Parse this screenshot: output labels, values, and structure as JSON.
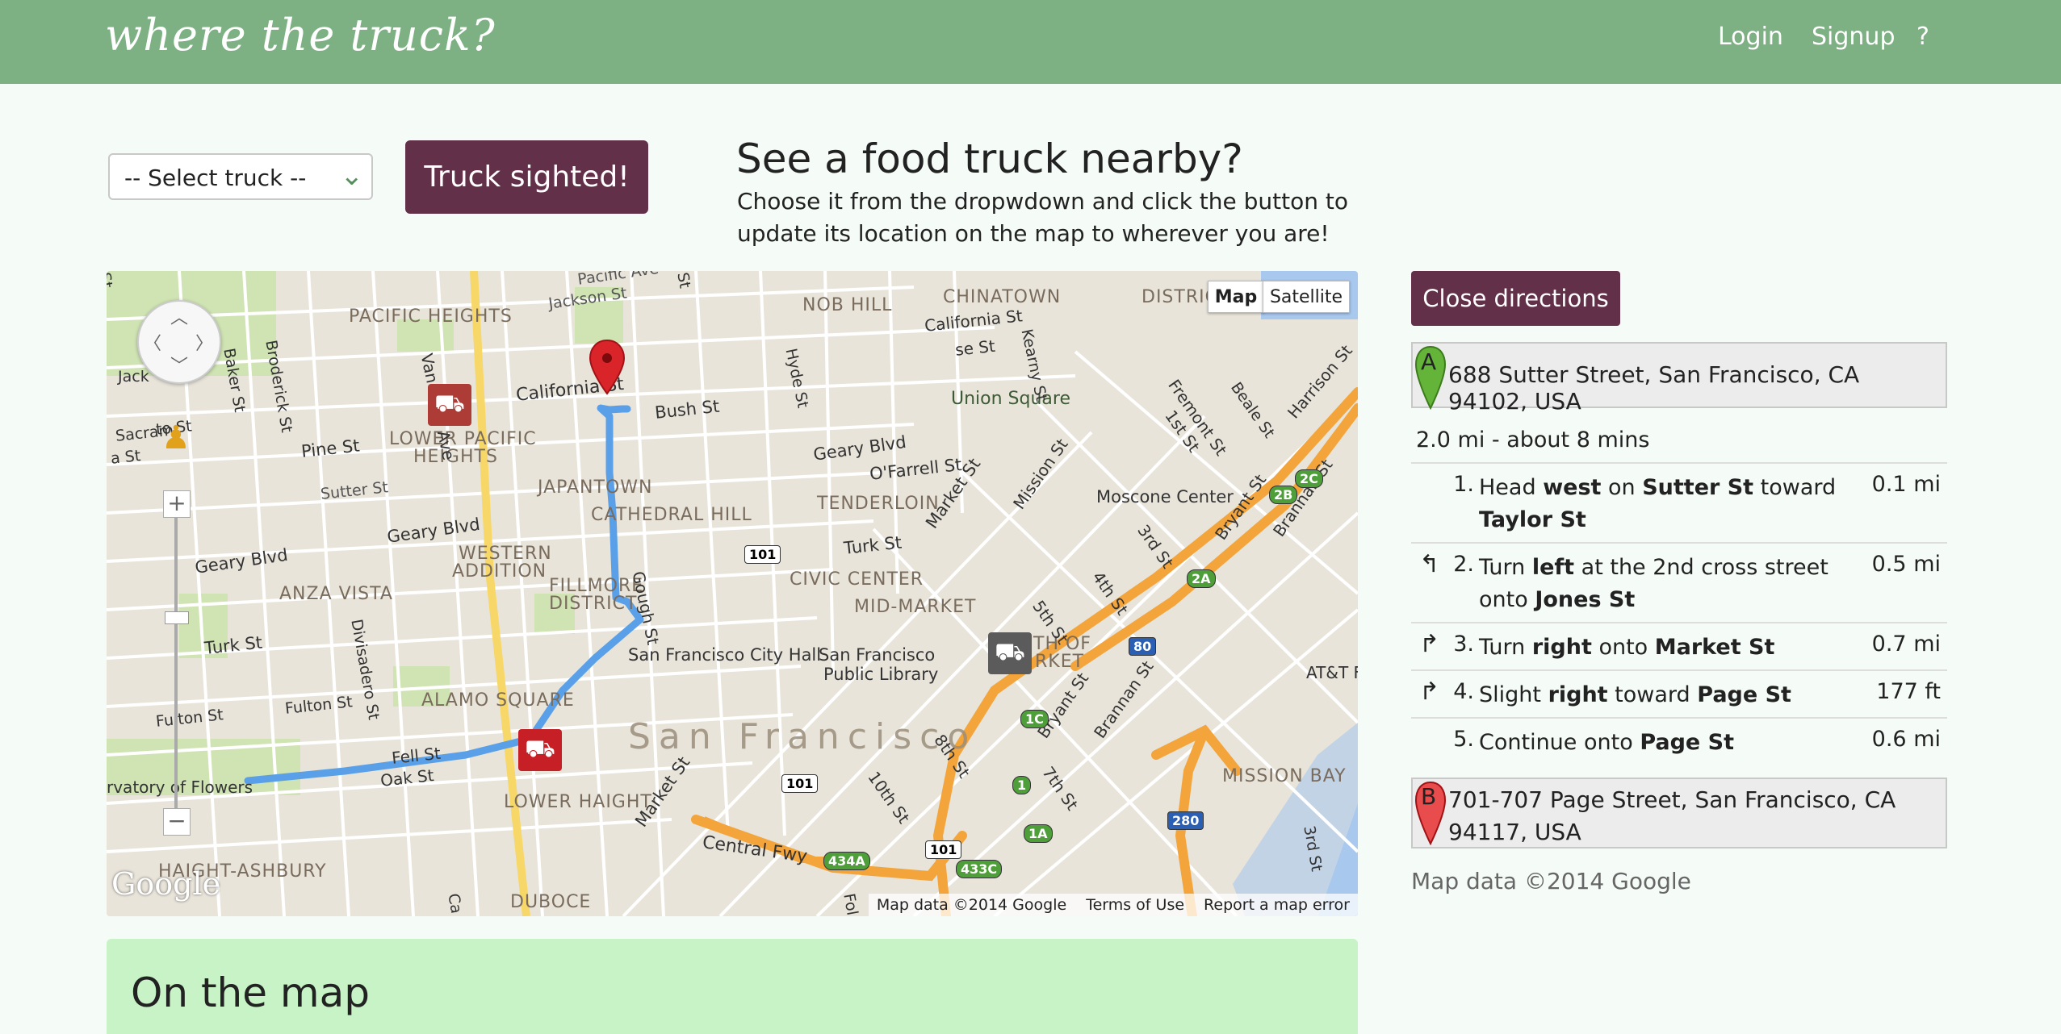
{
  "header": {
    "brand": "where the truck?",
    "nav": {
      "login": "Login",
      "signup": "Signup",
      "help": "?"
    }
  },
  "sighting": {
    "select_value": "-- Select truck --",
    "button_label": "Truck sighted!",
    "title": "See a food truck nearby?",
    "subtitle_line1": "Choose it from the dropwdown and click the button to",
    "subtitle_line2": "update its location on the map to wherever you are!"
  },
  "map": {
    "type_buttons": {
      "map": "Map",
      "satellite": "Satellite"
    },
    "footer": {
      "data": "Map data ©2014 Google",
      "terms": "Terms of Use",
      "report": "Report a map error"
    },
    "logo": "Google",
    "city_label": "San Francisco",
    "labels": {
      "chinatown": "CHINATOWN",
      "district": "DISTRICT",
      "pacific_heights": "PACIFIC HEIGHTS",
      "nob_hill": "NOB HILL",
      "lower_pacific_heights": "LOWER PACIFIC",
      "heights": "HEIGHTS",
      "japantown": "JAPANTOWN",
      "cathedral_hill": "CATHEDRAL HILL",
      "tenderloin": "TENDERLOIN",
      "western_addition": "WESTERN",
      "addition": "ADDITION",
      "fillmore": "FILLMORE",
      "fillmore_district": "DISTRICT",
      "anza_vista": "ANZA VISTA",
      "civic_center": "CIVIC CENTER",
      "mid_market": "MID-MARKET",
      "alamo_square": "ALAMO SQUARE",
      "lower_haight": "LOWER HAIGHT",
      "haight_ashbury": "HAIGHT-ASHBURY",
      "duboce": "DUBOCE",
      "mission_bay": "MISSION BAY",
      "union_square": "Union Square",
      "moscone_center": "Moscone Center",
      "sf_city_hall": "San Francisco City Hall",
      "sf_public_library": "San Francisco",
      "public_library": "Public Library",
      "conservatory": "rvatory of Flowers",
      "soma": "TH OF",
      "soma2": "RKET",
      "att_park": "AT&T F"
    },
    "streets": {
      "pacific_ave": "Pacific Ave",
      "jackson_st": "Jackson St",
      "california_st": "California St",
      "california_st2": "California St",
      "bush_st": "Bush St",
      "pine_st": "Pine St",
      "sutter_st": "Sutter St",
      "geary_blvd": "Geary Blvd",
      "geary_blvd2": "Geary Blvd",
      "geary_blvd3": "Geary Blvd",
      "ofarrell_st": "O'Farrell St",
      "turk_st": "Turk St",
      "turk_st2": "Turk St",
      "fulton_st": "Fulton St",
      "fulton_st2": "Fulton St",
      "fell_st": "Fell St",
      "oak_st": "Oak St",
      "van_ness_ave": "Van Ness Ave",
      "hyde_st": "Hyde St",
      "kearny_st": "Kearny St",
      "gough_st": "Gough St",
      "divisadero_st": "Divisadero St",
      "baker_st": "Baker St",
      "broderick_st": "Broderick St",
      "market_st": "Market St",
      "market_st2": "Market St",
      "mission_st": "Mission St",
      "fremont_st": "Fremont St",
      "first_st": "1st St",
      "beale_st": "Beale St",
      "harrison_st": "Harrison St",
      "bryant_st": "Bryant St",
      "brannan_st": "Brannan St",
      "third_st": "3rd St",
      "third_st2": "3rd St",
      "fourth_st": "4th St",
      "fifth_st": "5th St",
      "seventh_st": "7th St",
      "eighth_st": "8th St",
      "tenth_st": "10th St",
      "bryant_st2": "Bryant St",
      "brannan_st2": "Brannan St",
      "central_fwy": "Central Fwy",
      "jack": "Jack",
      "sacramento": "Sacram",
      "to_st": "to St",
      "a_st": "a St",
      "fol": "Fol",
      "ca": "Ca",
      "se_st": "se St",
      "st_top": "St",
      "st_top2": "St"
    },
    "shields": {
      "us101": "101",
      "us101b": "101",
      "us101c": "101",
      "i80": "80",
      "i280": "280",
      "r1": "1",
      "r1a": "1A",
      "r1c": "1C",
      "r2a": "2A",
      "r2b": "2B",
      "r2c": "2C",
      "r434a": "434A",
      "r433c": "433C"
    }
  },
  "directions": {
    "close_label": "Close directions",
    "start_marker": "A",
    "start": "688 Sutter Street, San Francisco, CA 94102, USA",
    "summary": "2.0 mi - about 8 mins",
    "steps": [
      {
        "num": "1.",
        "turn": "",
        "parts": [
          "Head ",
          "west",
          " on ",
          "Sutter St",
          " toward ",
          "Taylor St"
        ],
        "distance": "0.1 mi"
      },
      {
        "num": "2.",
        "turn": "↰",
        "parts": [
          "Turn ",
          "left",
          " at the 2nd cross street onto ",
          "Jones St"
        ],
        "distance": "0.5 mi"
      },
      {
        "num": "3.",
        "turn": "↱",
        "parts": [
          "Turn ",
          "right",
          " onto ",
          "Market St"
        ],
        "distance": "0.7 mi"
      },
      {
        "num": "4.",
        "turn": "↱",
        "parts": [
          "Slight ",
          "right",
          " toward ",
          "Page St"
        ],
        "distance": "177 ft"
      },
      {
        "num": "5.",
        "turn": "",
        "parts": [
          "Continue onto ",
          "Page St"
        ],
        "distance": "0.6 mi"
      }
    ],
    "end_marker": "B",
    "end": "701-707 Page Street, San Francisco, CA 94117, USA",
    "copyright": "Map data ©2014 Google"
  },
  "on_the_map": {
    "title": "On the map"
  },
  "colors": {
    "header_bg": "#7db083",
    "brand_button": "#63304a",
    "route": "#5aa0e8",
    "freeway": "#f3a43b",
    "marker_red": "#d9252a",
    "marker_green": "#64b43a"
  }
}
